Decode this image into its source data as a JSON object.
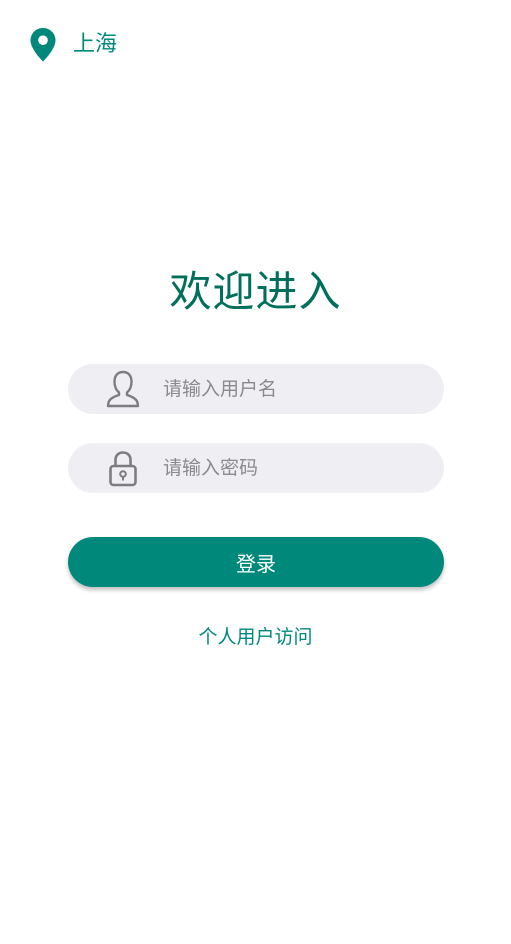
{
  "location": {
    "city": "上海",
    "icon": "location-pin-icon",
    "color": "#00897b"
  },
  "title": "欢迎进入",
  "username_field": {
    "placeholder": "请输入用户名",
    "value": "",
    "icon": "user-icon"
  },
  "password_field": {
    "placeholder": "请输入密码",
    "value": "",
    "icon": "lock-icon"
  },
  "login_button": {
    "label": "登录",
    "color": "#00897b"
  },
  "personal_access_link": {
    "label": "个人用户访问"
  },
  "colors": {
    "accent": "#00897b",
    "title": "#00705a",
    "field_background": "#efeff3"
  }
}
